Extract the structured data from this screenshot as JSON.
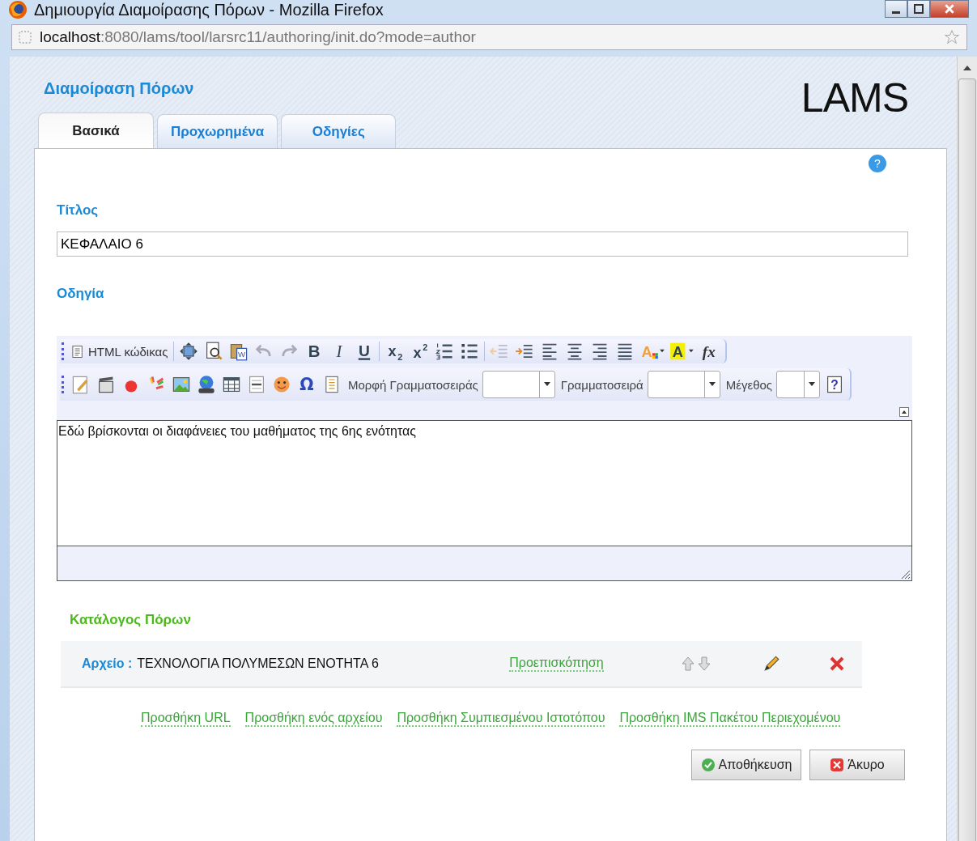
{
  "window": {
    "title": "Δημιουργία Διαμοίρασης Πόρων - Mozilla Firefox"
  },
  "address_bar": {
    "host": "localhost",
    "path": ":8080/lams/tool/larsrc11/authoring/init.do?mode=author"
  },
  "page_title": "Διαμοίραση Πόρων",
  "logo": "LAMS",
  "tabs": [
    {
      "label": "Βασικά",
      "selected": true
    },
    {
      "label": "Προχωρημένα",
      "selected": false
    },
    {
      "label": "Οδηγίες",
      "selected": false
    }
  ],
  "title_field": {
    "label": "Τίτλος",
    "value": "ΚΕΦΑΛΑΙΟ 6"
  },
  "instructions": {
    "label": "Οδηγία",
    "source_button": "HTML κώδικας",
    "font_format_label": "Μορφή Γραμματοσειράς",
    "font_label": "Γραμματοσειρά",
    "size_label": "Μέγεθος",
    "glyphs": {
      "help": "?",
      "word": "W",
      "bold": "B",
      "italic": "I",
      "underline": "U",
      "sub_base": "x",
      "sub_mark": "2",
      "sup_base": "x",
      "sup_mark": "2",
      "text_color": "A",
      "highlight": "A",
      "formula": "fx",
      "omega": "Ω",
      "editor_help": "?"
    },
    "text": "Εδώ βρίσκονται οι διαφάνειες του μαθήματος της 6ης ενότητας"
  },
  "resources": {
    "heading": "Κατάλογος Πόρων",
    "items": [
      {
        "type": "Αρχείο :",
        "name": "ΤΕΧΝΟΛΟΓΙΑ ΠΟΛΥΜΕΣΩΝ ΕΝΟΤΗΤΑ 6",
        "preview": "Προεπισκόπηση"
      }
    ],
    "add_links": [
      "Προσθήκη URL",
      "Προσθήκη ενός αρχείου",
      "Προσθήκη Συμπιεσμένου Ιστοτόπου",
      "Προσθήκη IMS Πακέτου Περιεχομένου"
    ]
  },
  "buttons": [
    {
      "kind": "save",
      "label": "Αποθήκευση"
    },
    {
      "kind": "cancel",
      "label": "Άκυρο"
    }
  ]
}
